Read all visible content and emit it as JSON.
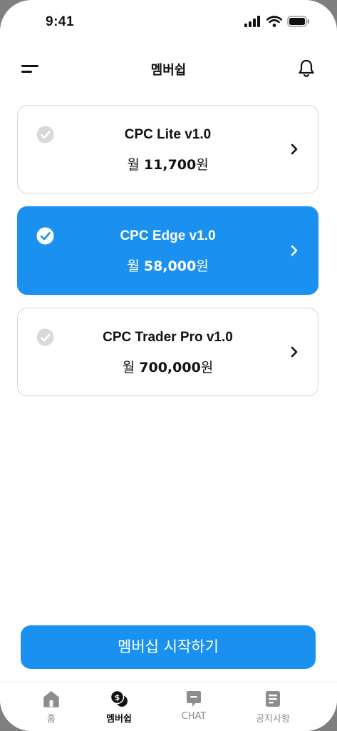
{
  "status_bar": {
    "time": "9:41"
  },
  "header": {
    "title": "멤버쉽"
  },
  "plans": [
    {
      "name": "CPC Lite v1.0",
      "price_prefix": "월 ",
      "price_amount": "11,700",
      "price_suffix": "원",
      "selected": false
    },
    {
      "name": "CPC Edge v1.0",
      "price_prefix": "월 ",
      "price_amount": "58,000",
      "price_suffix": "원",
      "selected": true
    },
    {
      "name": "CPC Trader Pro v1.0",
      "price_prefix": "월 ",
      "price_amount": "700,000",
      "price_suffix": "원",
      "selected": false
    }
  ],
  "start_button": {
    "label": "멤버십 시작하기"
  },
  "tabs": [
    {
      "label": "홈",
      "icon": "home-icon",
      "active": false
    },
    {
      "label": "멤버쉽",
      "icon": "coins-icon",
      "active": true
    },
    {
      "label": "CHAT",
      "icon": "chat-icon",
      "active": false
    },
    {
      "label": "공지사항",
      "icon": "notice-icon",
      "active": false
    }
  ],
  "colors": {
    "accent": "#1a91f0",
    "card_border": "#d6d6d6",
    "inactive_check": "#d9d9d9",
    "inactive_tab": "#8c8c8c"
  }
}
